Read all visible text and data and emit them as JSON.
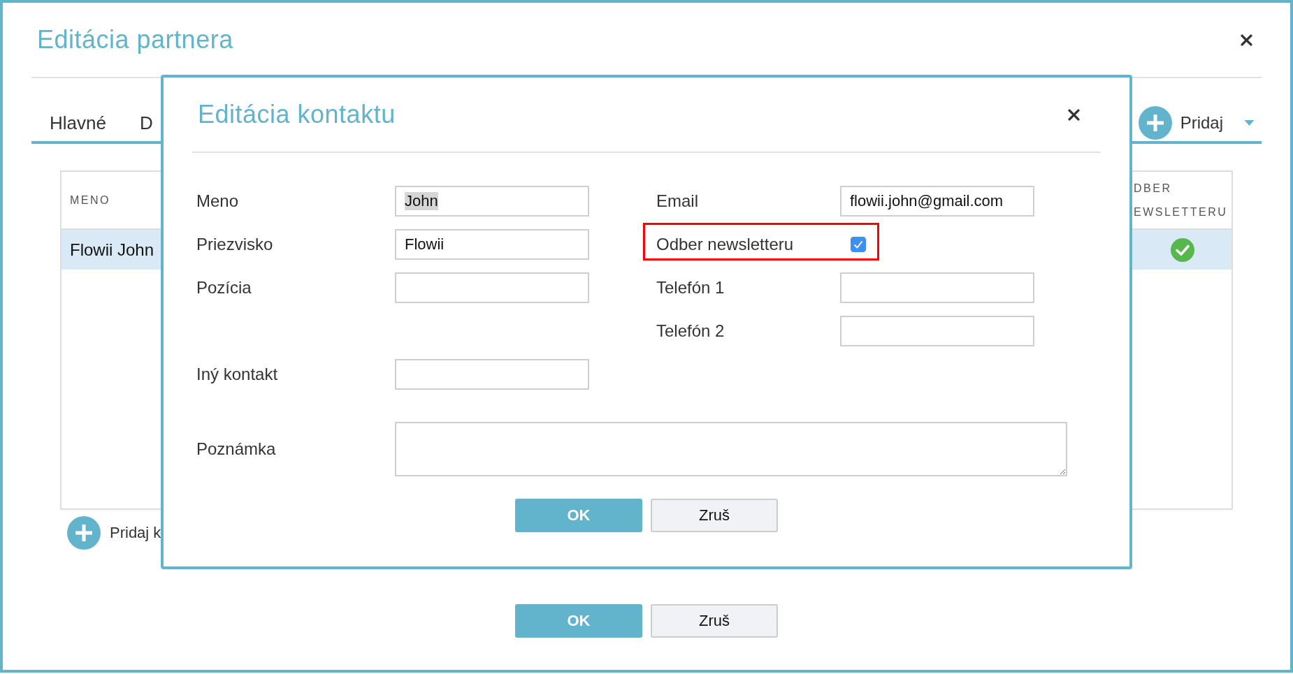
{
  "window": {
    "title": "Editácia partnera"
  },
  "tabs": [
    {
      "label": "Hlavné"
    },
    {
      "label": "D"
    }
  ],
  "add_menu": {
    "label": "Pridaj"
  },
  "contacts_table": {
    "columns": [
      "MENO",
      "DBER EWSLETTERU"
    ],
    "rows": [
      {
        "name": "Flowii John",
        "newsletter": true,
        "selected": true
      }
    ]
  },
  "add_contact": {
    "label": "Pridaj k"
  },
  "buttons": [
    {
      "label": "OK",
      "kind": "primary"
    },
    {
      "label": "Zruš",
      "kind": "secondary"
    }
  ],
  "contact_dialog": {
    "title": "Editácia kontaktu",
    "left_fields": [
      {
        "label": "Meno",
        "kind": "text",
        "value": "John",
        "text_selected": true
      },
      {
        "label": "Priezvisko",
        "kind": "text",
        "value": "Flowii"
      },
      {
        "label": "Pozícia",
        "kind": "text"
      },
      {
        "label": "Iný kontakt",
        "kind": "text"
      }
    ],
    "right_fields": [
      {
        "label": "Email",
        "kind": "text",
        "value": "flowii.john@gmail.com"
      },
      {
        "label": "Odber newsletteru",
        "kind": "checkbox",
        "checked": true,
        "highlighted": true
      },
      {
        "label": "Telefón 1",
        "kind": "text"
      },
      {
        "label": "Telefón 2",
        "kind": "text"
      }
    ],
    "note": {
      "label": "Poznámka"
    },
    "buttons": [
      {
        "label": "OK",
        "kind": "primary"
      },
      {
        "label": "Zruš",
        "kind": "secondary"
      }
    ]
  }
}
